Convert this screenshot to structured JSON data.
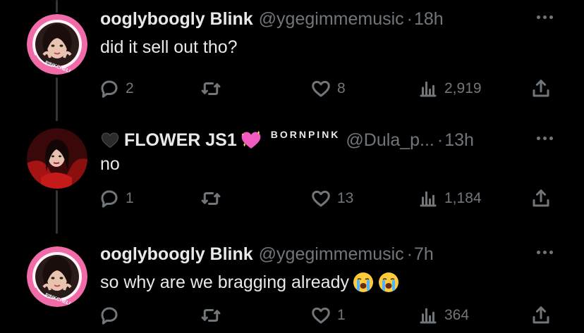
{
  "tweets": [
    {
      "display_name": "ooglyboogly Blink",
      "handle": "@ygegimmemusic",
      "separator": "·",
      "time": "18h",
      "text": "did it sell out tho?",
      "replies": "2",
      "retweets": "",
      "likes": "8",
      "views": "2,919",
      "avatar_caption": "PINKCHELLA"
    },
    {
      "display_name": "FLOWER JS1",
      "badge_text": "BORNPINK",
      "handle": "@Dula_p...",
      "separator": "·",
      "time": "13h",
      "text": "no",
      "replies": "1",
      "retweets": "",
      "likes": "13",
      "views": "1,184"
    },
    {
      "display_name": "ooglyboogly Blink",
      "handle": "@ygegimmemusic",
      "separator": "·",
      "time": "7h",
      "text": "so why are we bragging already",
      "replies": "",
      "retweets": "",
      "likes": "1",
      "views": "364",
      "avatar_caption": "PINKCHELLA"
    }
  ],
  "icons": {
    "reply": "reply-icon",
    "retweet": "retweet-icon",
    "like": "heart-icon",
    "views": "views-icon",
    "share": "share-icon",
    "more": "more-icon"
  },
  "colors": {
    "background": "#000000",
    "text": "#e7e9ea",
    "muted": "#71767b",
    "avatar_ring": "#f06ba8"
  }
}
